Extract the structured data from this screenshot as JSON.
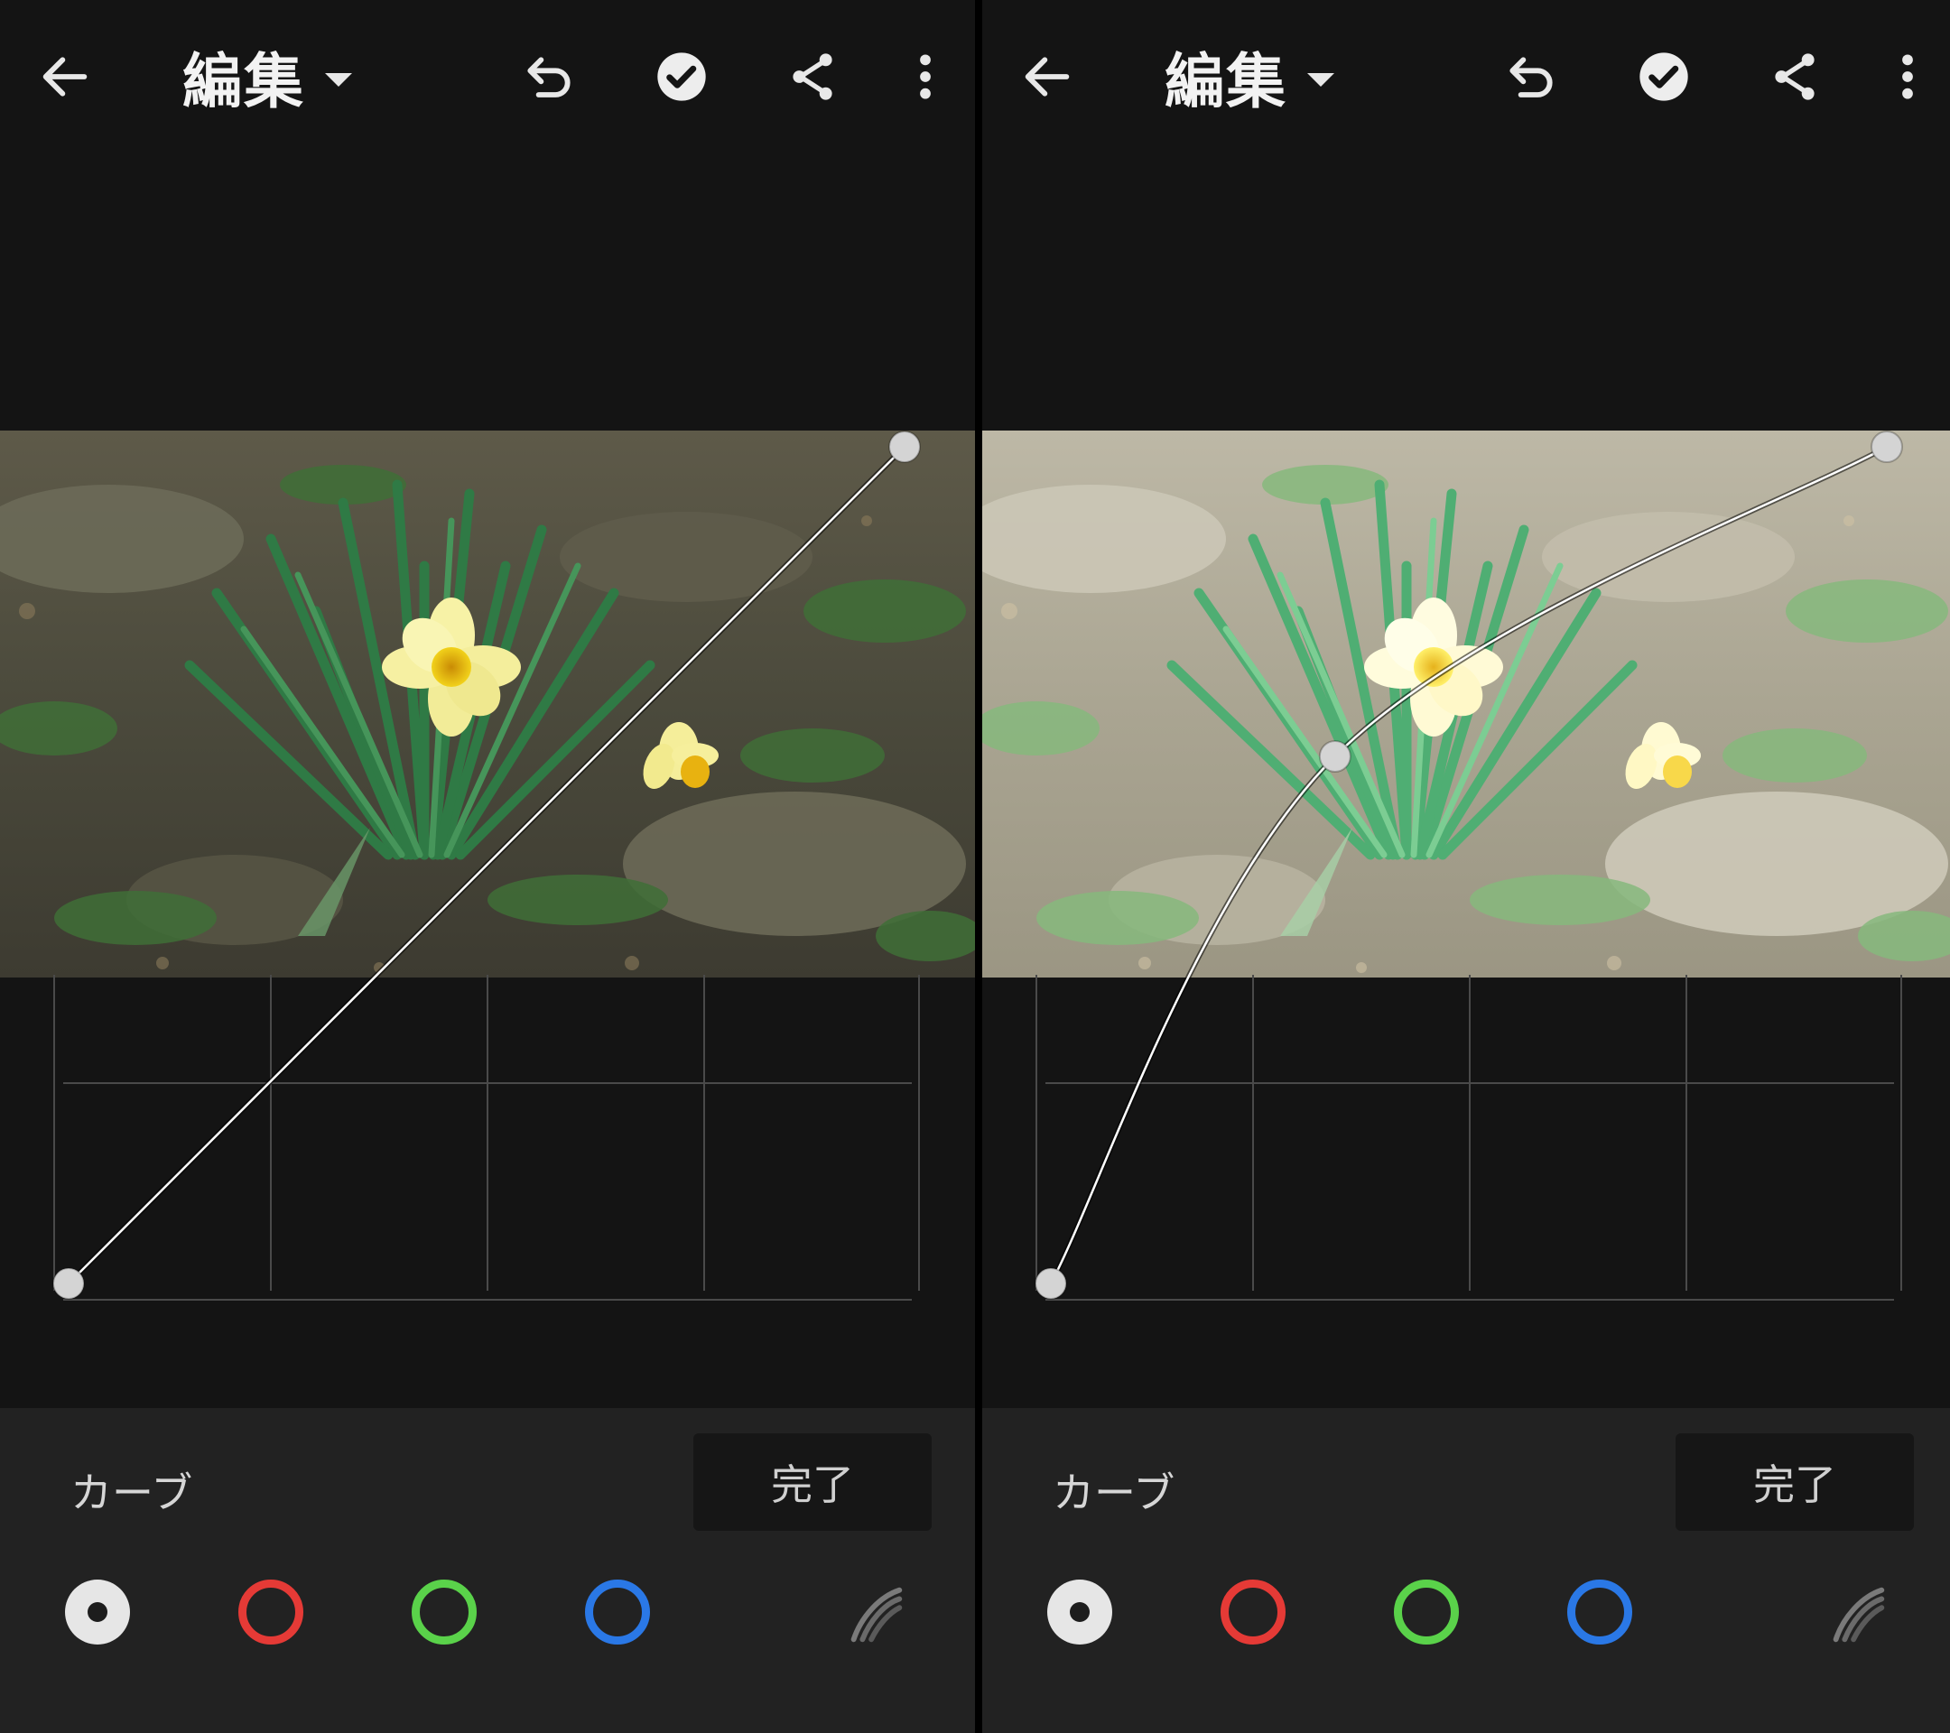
{
  "panels": [
    {
      "id": "left",
      "header": {
        "title": "編集"
      },
      "tool": {
        "label": "カーブ",
        "done_label": "完了"
      },
      "curve": {
        "points": [
          [
            0,
            0
          ],
          [
            1,
            1
          ]
        ],
        "smooth": false
      },
      "photo_variant": "original"
    },
    {
      "id": "right",
      "header": {
        "title": "編集"
      },
      "tool": {
        "label": "カーブ",
        "done_label": "完了"
      },
      "curve": {
        "points": [
          [
            0,
            0
          ],
          [
            0.34,
            0.63
          ],
          [
            1,
            1
          ]
        ],
        "smooth": true
      },
      "photo_variant": "brightened"
    }
  ],
  "icons": {
    "back": "arrow-left-icon",
    "title_menu": "caret-down-icon",
    "undo": "undo-icon",
    "apply": "check-circle-icon",
    "share": "share-icon",
    "more": "more-vertical-icon",
    "preset": "swirl-icon"
  },
  "channels": [
    {
      "name": "rgb",
      "color": "#e6e6e6"
    },
    {
      "name": "red",
      "color": "#e53a36"
    },
    {
      "name": "green",
      "color": "#5ad24a"
    },
    {
      "name": "blue",
      "color": "#2a78e6"
    }
  ],
  "colors": {
    "background": "#141414",
    "toolbar": "#222222",
    "curve": "#ffffff",
    "grid": "#4a4a4a"
  }
}
